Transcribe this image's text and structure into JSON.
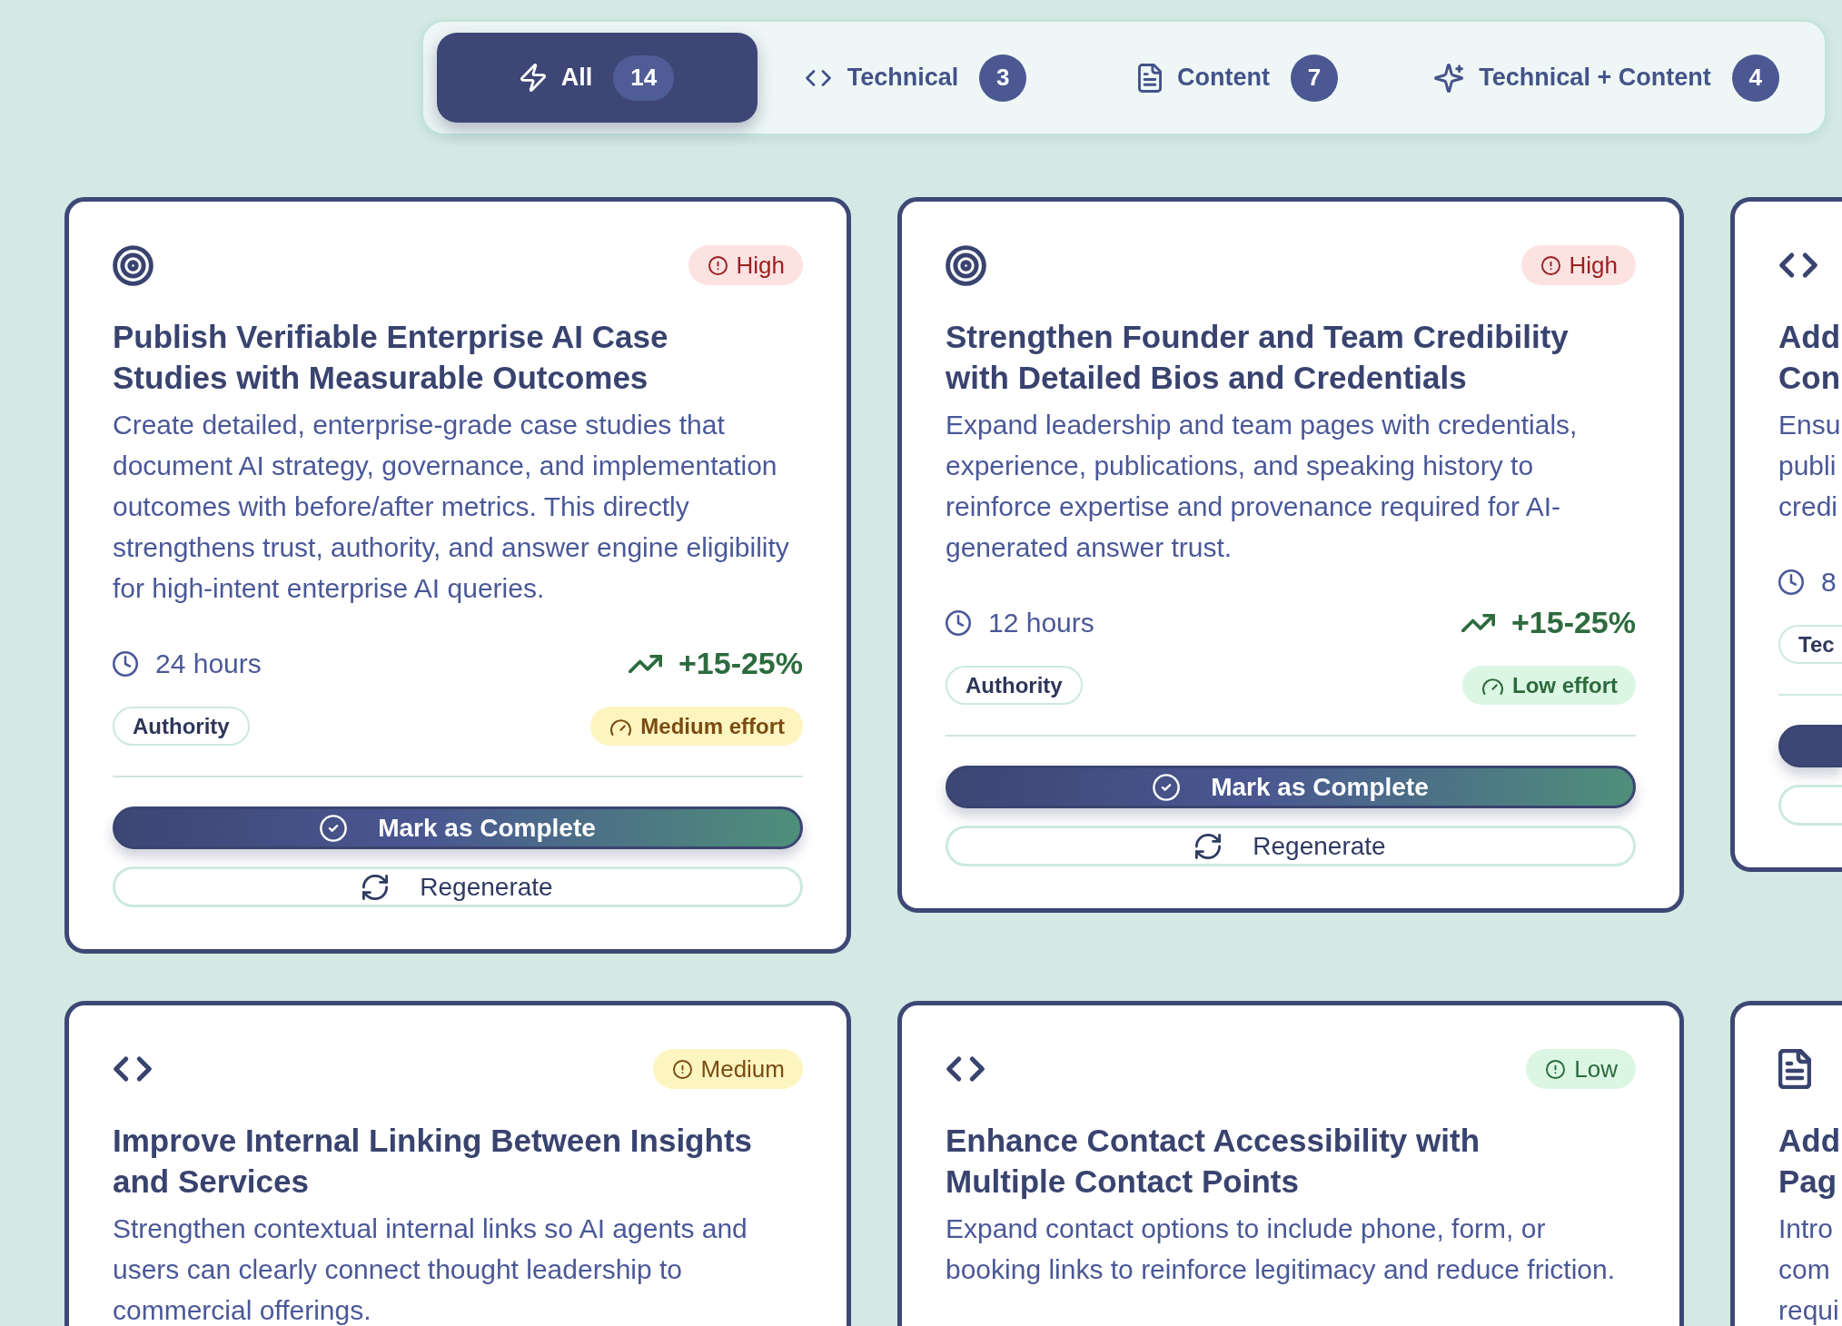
{
  "filter_tabs": [
    {
      "kind": "all",
      "label": "All",
      "count": "14",
      "selected": true
    },
    {
      "kind": "technical",
      "label": "Technical",
      "count": "3",
      "selected": false
    },
    {
      "kind": "content",
      "label": "Content",
      "count": "7",
      "selected": false
    },
    {
      "kind": "combined",
      "label": "Technical + Content",
      "count": "4",
      "selected": false
    }
  ],
  "cards": [
    {
      "kind": "target",
      "priority": {
        "kind": "high",
        "label": "High"
      },
      "title": "Publish Verifiable Enterprise AI Case Studies with Measurable Outcomes",
      "description": "Create detailed, enterprise-grade case studies that document AI strategy, governance, and implementation outcomes with before/after metrics. This directly strengthens trust, authority, and answer engine eligibility for high-intent enterprise AI queries.",
      "time": "24 hours",
      "impact": "+15-25%",
      "tag": "Authority",
      "effort": {
        "kind": "medium",
        "label": "Medium effort"
      },
      "actions": [
        {
          "kind": "complete",
          "label": "Mark as Complete"
        },
        {
          "kind": "regenerate",
          "label": "Regenerate"
        }
      ]
    },
    {
      "kind": "target",
      "priority": {
        "kind": "high",
        "label": "High"
      },
      "title": "Strengthen Founder and Team Credibility with Detailed Bios and Credentials",
      "description": "Expand leadership and team pages with credentials, experience, publications, and speaking history to reinforce expertise and provenance required for AI-generated answer trust.",
      "time": "12 hours",
      "impact": "+15-25%",
      "tag": "Authority",
      "effort": {
        "kind": "low",
        "label": "Low effort"
      },
      "actions": [
        {
          "kind": "complete",
          "label": "Mark as Complete"
        },
        {
          "kind": "regenerate",
          "label": "Regenerate"
        }
      ]
    },
    {
      "kind": "code",
      "title": "Add\nCon",
      "description": "Ensu\npubli\ncredi",
      "time": "8",
      "tag": "Tec",
      "actions": [
        {
          "kind": "complete"
        },
        {
          "kind": "regenerate"
        }
      ]
    },
    {
      "kind": "code",
      "priority": {
        "kind": "medium",
        "label": "Medium"
      },
      "title": "Improve Internal Linking Between Insights and Services",
      "description": "Strengthen contextual internal links so AI agents and users can clearly connect thought leadership to commercial offerings."
    },
    {
      "kind": "code",
      "priority": {
        "kind": "low",
        "label": "Low"
      },
      "title": "Enhance Contact Accessibility with Multiple Contact Points",
      "description": "Expand contact options to include phone, form, or booking links to reinforce legitimacy and reduce friction."
    },
    {
      "kind": "document",
      "title": "Add\nPag",
      "description": "Intro\ncom\nrequi"
    }
  ]
}
